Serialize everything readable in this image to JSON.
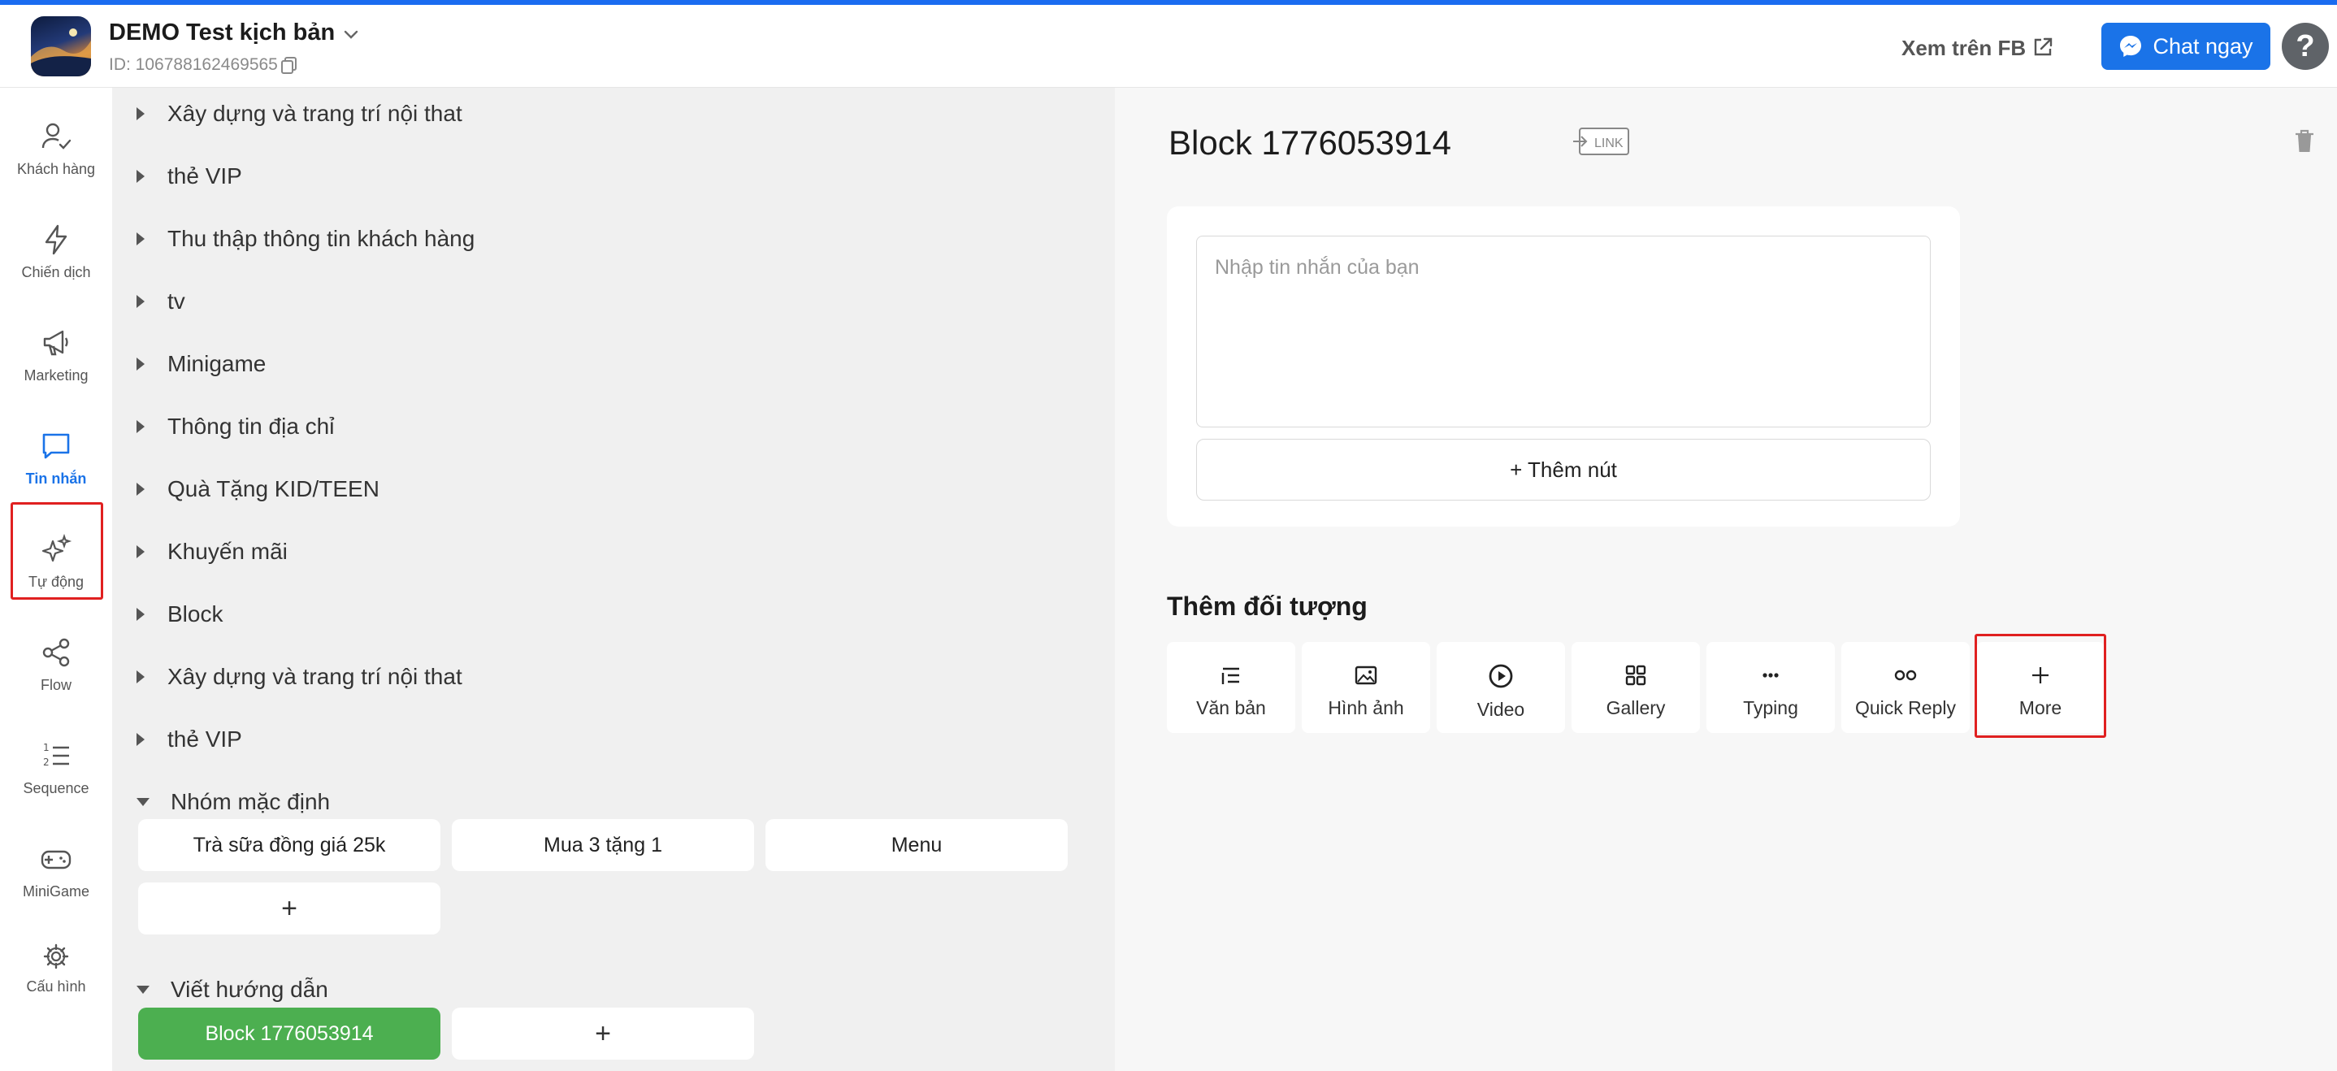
{
  "header": {
    "page_name": "DEMO Test kịch bản",
    "page_id": "ID: 106788162469565",
    "view_on_fb": "Xem trên FB",
    "chat_now": "Chat ngay",
    "help": "?"
  },
  "sidebar": {
    "items": [
      {
        "label": "Khách hàng",
        "icon": "user-check-icon"
      },
      {
        "label": "Chiến dịch",
        "icon": "lightning-icon"
      },
      {
        "label": "Marketing",
        "icon": "megaphone-icon"
      },
      {
        "label": "Tin nhắn",
        "icon": "chat-bubble-icon",
        "active": true
      },
      {
        "label": "Tự động",
        "icon": "sparkles-icon"
      },
      {
        "label": "Flow",
        "icon": "share-nodes-icon"
      },
      {
        "label": "Sequence",
        "icon": "numbered-list-icon"
      },
      {
        "label": "MiniGame",
        "icon": "gamepad-icon"
      },
      {
        "label": "Cấu hình",
        "icon": "gear-icon"
      }
    ]
  },
  "groups": [
    "Xây dựng và trang trí nội that",
    "thẻ VIP",
    "Thu thập thông tin khách hàng",
    "tv",
    "Minigame",
    "Thông tin địa chỉ",
    "Quà Tặng KID/TEEN",
    "Khuyến mãi",
    "Block",
    "Xây dựng và trang trí nội that",
    "thẻ VIP"
  ],
  "default_group": {
    "name": "Nhóm mặc định",
    "blocks": [
      "Trà sữa đồng giá 25k",
      "Mua 3 tặng 1",
      "Menu"
    ],
    "add": "+"
  },
  "guide_group": {
    "name": "Viết hướng dẫn",
    "blocks": [
      "Block 1776053914"
    ],
    "add": "+"
  },
  "editor": {
    "block_title": "Block 1776053914",
    "link_tag": "LINK",
    "message_placeholder": "Nhập tin nhắn của bạn",
    "message_value": "",
    "add_button": "+ Thêm nút",
    "add_object_title": "Thêm đối tượng",
    "objects": [
      {
        "label": "Văn bản",
        "icon": "text-lines-icon"
      },
      {
        "label": "Hình ảnh",
        "icon": "image-icon"
      },
      {
        "label": "Video",
        "icon": "play-circle-icon"
      },
      {
        "label": "Gallery",
        "icon": "grid-icon"
      },
      {
        "label": "Typing",
        "icon": "dots-icon"
      },
      {
        "label": "Quick Reply",
        "icon": "two-circles-icon"
      },
      {
        "label": "More",
        "icon": "plus-icon"
      }
    ]
  },
  "colors": {
    "accent": "#1a73e8",
    "highlight": "#e02020",
    "active_block": "#4caf50"
  }
}
